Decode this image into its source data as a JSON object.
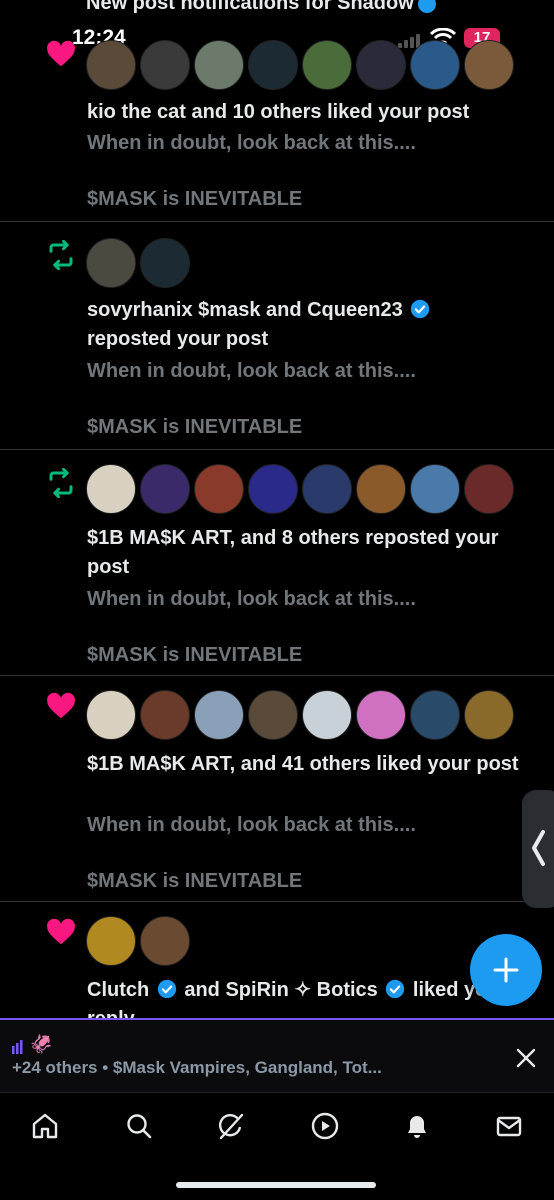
{
  "header_cut": {
    "text": "New post notifications for Shadow"
  },
  "status_bar": {
    "time": "12:24",
    "battery": "17"
  },
  "notifications": [
    {
      "type": "like",
      "avatars": [
        "#5a4a3a",
        "#3a3a3a",
        "#6b7a6b",
        "#1b2a33",
        "#4a6b3a",
        "#2a2a3a",
        "#2a5a8a",
        "#7a5a3a"
      ],
      "title": "kio the cat and 10 others liked your post",
      "snippet": "When in doubt, look back at this....",
      "caption": "$MASK is INEVITABLE"
    },
    {
      "type": "repost",
      "avatars": [
        "#4a4a40",
        "#1b2a33"
      ],
      "title_part1": "sovyrhanix $mask and Cqueen23",
      "title_part2": "reposted your post",
      "snippet": "When in doubt, look back at this....",
      "caption": "$MASK is INEVITABLE"
    },
    {
      "type": "repost",
      "avatars": [
        "#d8d0c0",
        "#3a2a6a",
        "#8a3a2a",
        "#2a2a8a",
        "#2a3a6a",
        "#8a5a2a",
        "#4a7aaa",
        "#6a2a2a"
      ],
      "title": "$1B MA$K ART, and 8 others reposted your post",
      "snippet": "When in doubt, look back at this....",
      "caption": "$MASK is INEVITABLE"
    },
    {
      "type": "like",
      "avatars": [
        "#d8d0c0",
        "#6a3a2a",
        "#8aa0b8",
        "#5a4a3a",
        "#c8d0d8",
        "#d070c0",
        "#2a4a6a",
        "#8a6a2a"
      ],
      "title": "$1B MA$K ART, and 41 others liked your post",
      "snippet": "When in doubt, look back at this....",
      "caption": "$MASK is INEVITABLE"
    },
    {
      "type": "like",
      "avatars": [
        "#b08a20",
        "#6a4a30"
      ],
      "title_part1": "Clutch",
      "title_part2": "and SpiRin ✧ Botics",
      "title_part3": "liked your",
      "title_part4": "reply"
    }
  ],
  "spaces_bar": {
    "others": "+24 others • $Mask Vampires, Gangland, Tot..."
  },
  "colors": {
    "like": "#f91880",
    "repost": "#00ba7c",
    "accent": "#1d9bf0",
    "bar_accent": "#7856ff"
  },
  "icons": [
    "heart-icon",
    "repost-icon",
    "verified-icon",
    "plus-icon",
    "close-icon",
    "home-icon",
    "search-icon",
    "grok-icon",
    "video-icon",
    "bell-icon",
    "mail-icon"
  ]
}
